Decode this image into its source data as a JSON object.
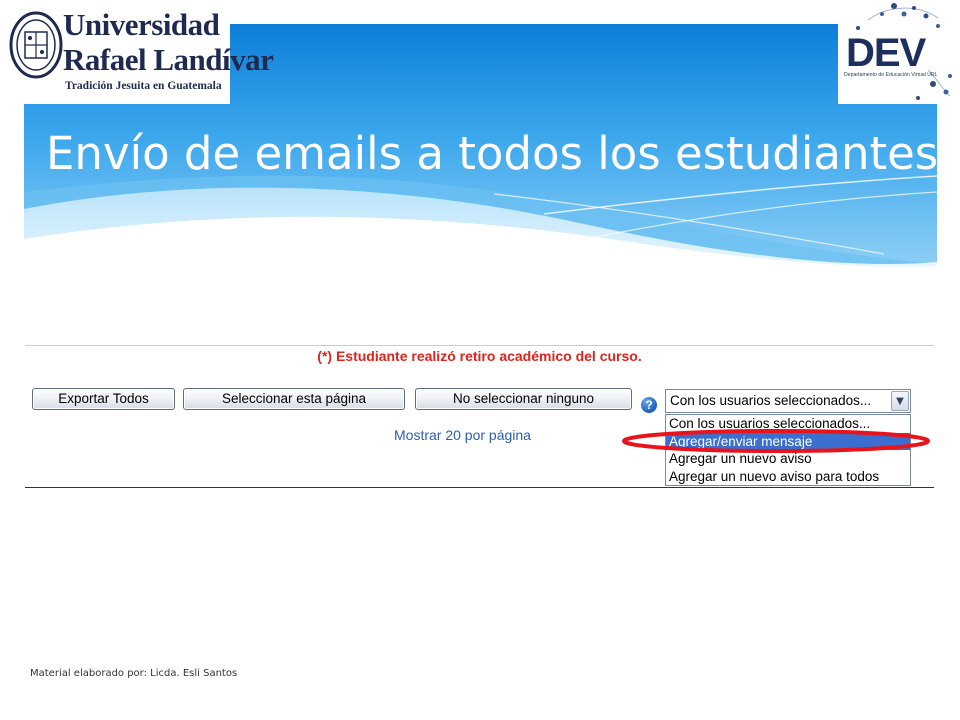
{
  "slide": {
    "title": "Envío de emails a todos los estudiantes",
    "footer": "Material elaborado por: Licda. Esli Santos"
  },
  "logos": {
    "university": {
      "line1": "Universidad",
      "line2": "Rafael Landívar",
      "line3": "Tradición Jesuita en Guatemala"
    },
    "dev": {
      "text": "DEV",
      "caption": "Departamento de Educación Virtual URL"
    }
  },
  "screenshot": {
    "notice": "(*) Estudiante realizó retiro académico del curso.",
    "buttons": {
      "export_all": "Exportar Todos",
      "select_page": "Seleccionar esta página",
      "select_none": "No seleccionar ninguno"
    },
    "help_glyph": "?",
    "per_page_link": "Mostrar 20 por página",
    "select": {
      "value": "Con los usuarios seleccionados...",
      "options": [
        "Con los usuarios seleccionados...",
        "Agregar/enviar mensaje",
        "Agregar un nuevo aviso",
        "Agregar un nuevo aviso para todos"
      ],
      "selected_index": 1
    }
  },
  "colors": {
    "banner_blue": "#1f8fe0",
    "notice_red": "#e0231b",
    "link_blue": "#2b5dbd",
    "highlight_red": "#e8141c",
    "selected_option": "#3a6fd0"
  }
}
